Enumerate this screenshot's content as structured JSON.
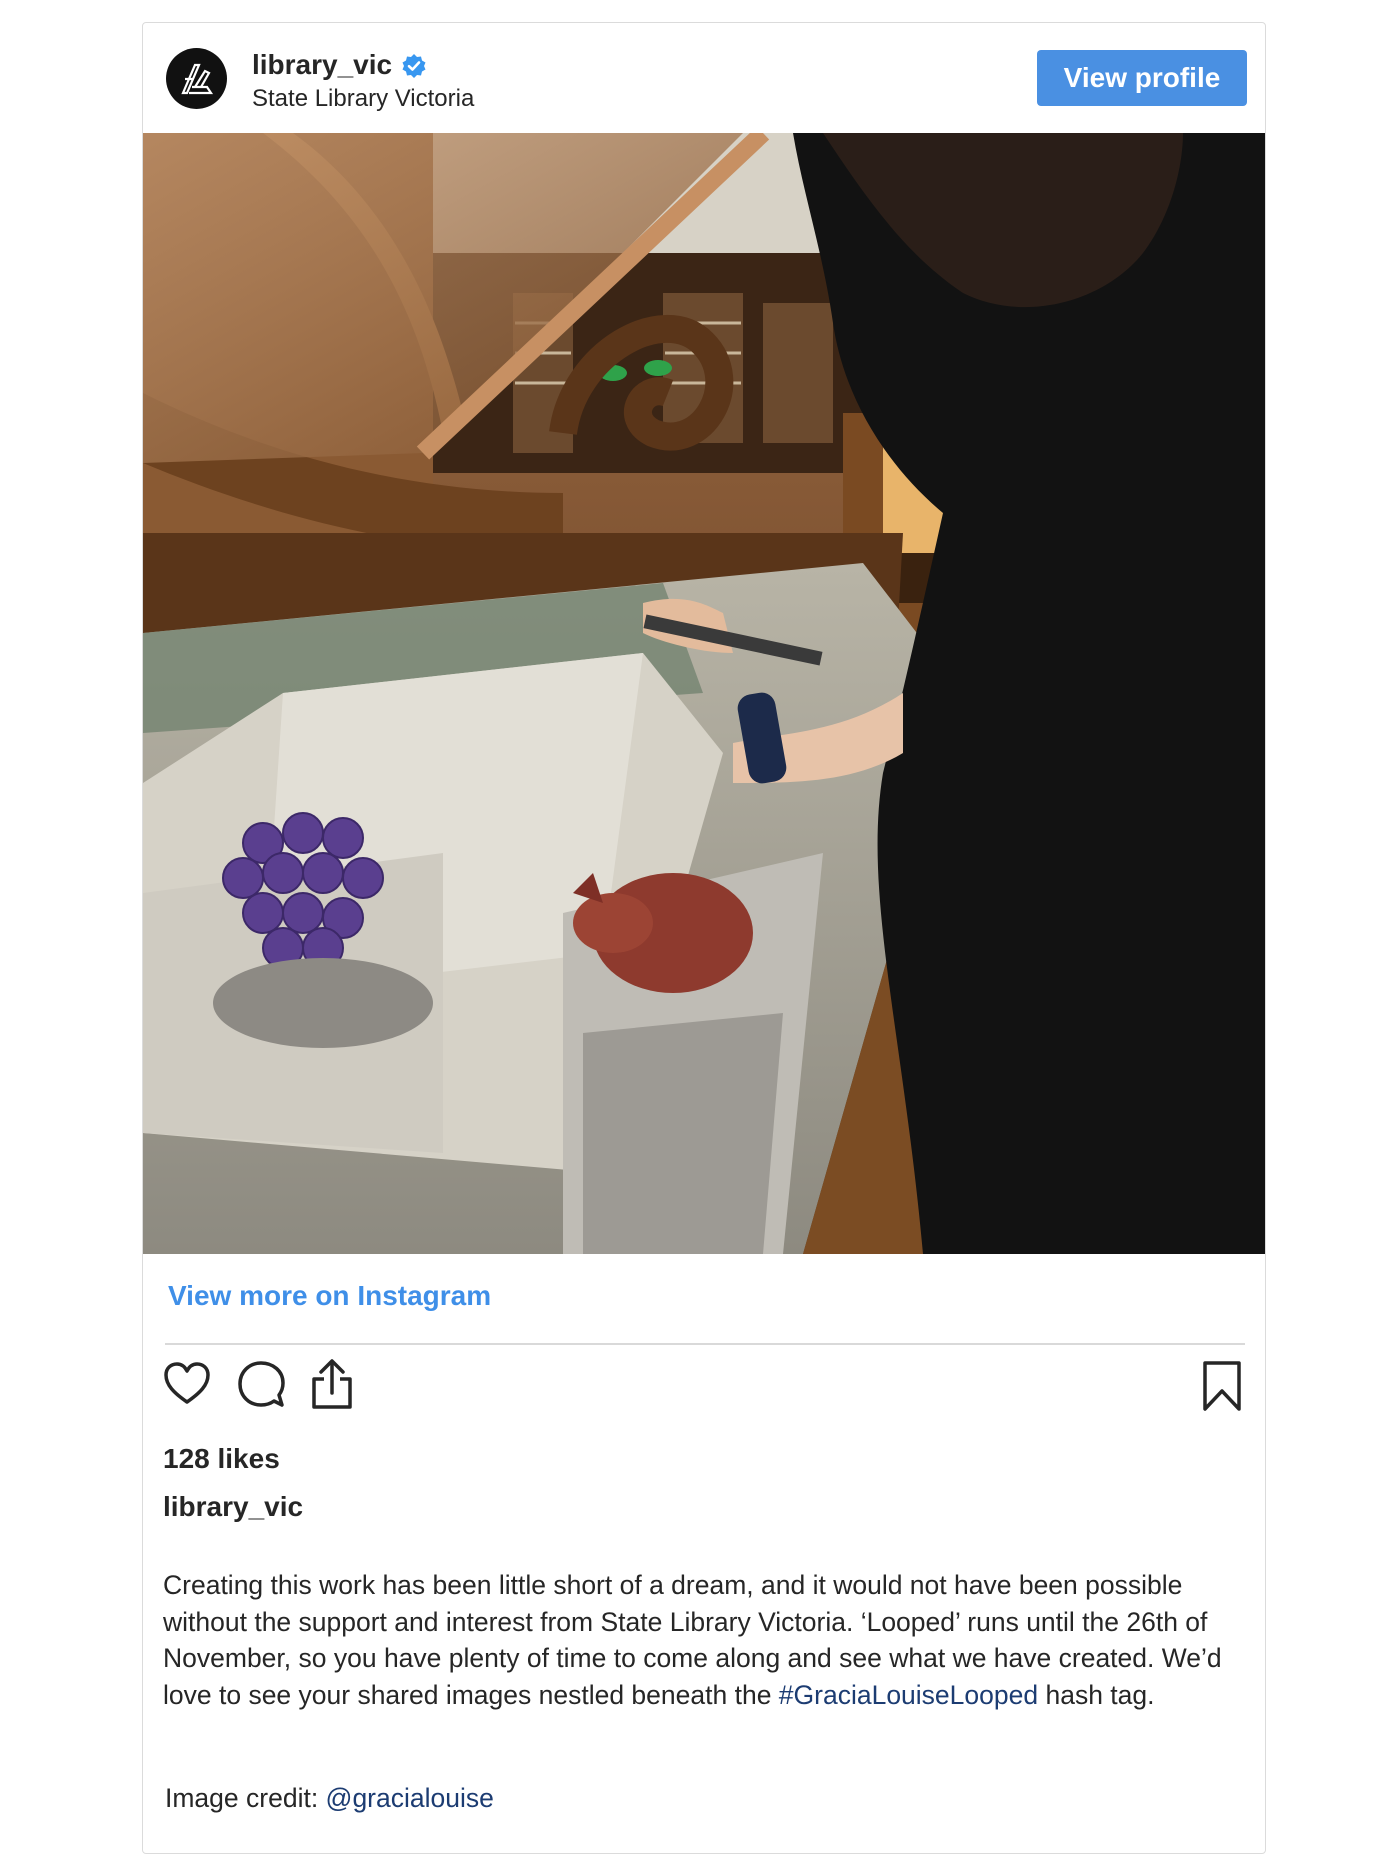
{
  "post": {
    "username": "library_vic",
    "full_name": "State Library Victoria",
    "view_profile_label": "View profile",
    "view_more_label": "View more on Instagram",
    "likes_text": "128 likes",
    "caption_user": "library_vic",
    "caption_text": "Creating this work has been little short of a dream, and it would not have been possible without the support and interest from State Library Victoria. ‘Looped’ runs until the 26th of November, so you have plenty of time to come along and see what we have created. We’d love to see your shared images nestled beneath the ",
    "caption_hashtag": "#GraciaLouiseLooped",
    "caption_suffix": " hash tag.",
    "credit_prefix": "Image credit: ",
    "credit_handle": "@gracialouise"
  },
  "icons": {
    "avatar": "state-library-logo",
    "verified": "verified-badge-icon",
    "like": "heart-icon",
    "comment": "comment-bubble-icon",
    "share": "share-icon",
    "save": "bookmark-icon"
  },
  "colors": {
    "accent": "#4a90e2",
    "link": "#3f8fe8",
    "hashtag": "#1c3c72",
    "text": "#262626",
    "border": "#dbdbdb"
  }
}
